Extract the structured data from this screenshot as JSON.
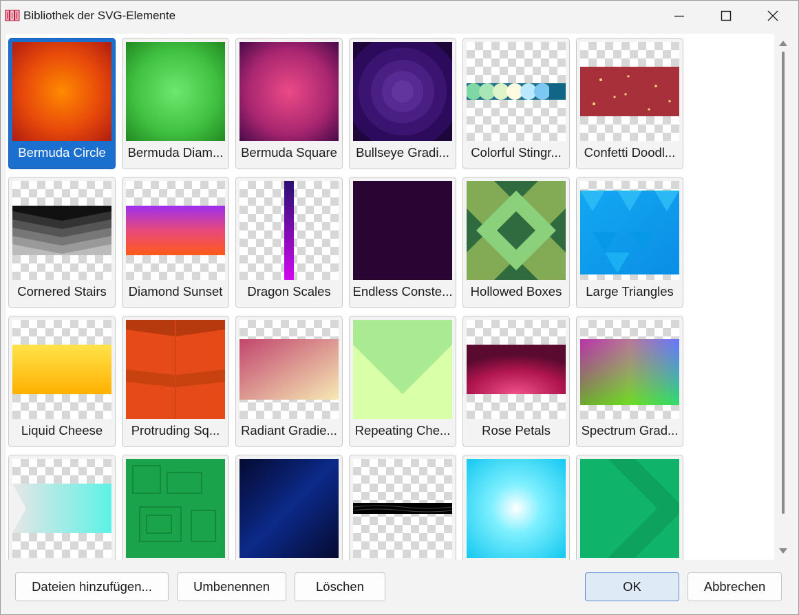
{
  "window": {
    "title": "Bibliothek der SVG-Elemente"
  },
  "tiles": [
    {
      "label": "Bermuda Circle",
      "selected": true
    },
    {
      "label": "Bermuda Diam..."
    },
    {
      "label": "Bermuda Square"
    },
    {
      "label": "Bullseye Gradi..."
    },
    {
      "label": "Colorful Stingr..."
    },
    {
      "label": "Confetti Doodl..."
    },
    {
      "label": "Cornered Stairs"
    },
    {
      "label": "Diamond Sunset"
    },
    {
      "label": "Dragon Scales"
    },
    {
      "label": "Endless Conste..."
    },
    {
      "label": "Hollowed Boxes"
    },
    {
      "label": "Large Triangles"
    },
    {
      "label": "Liquid Cheese"
    },
    {
      "label": "Protruding Sq..."
    },
    {
      "label": "Radiant Gradie..."
    },
    {
      "label": "Repeating Che..."
    },
    {
      "label": "Rose Petals"
    },
    {
      "label": "Spectrum Grad..."
    },
    {
      "label": ""
    },
    {
      "label": ""
    },
    {
      "label": ""
    },
    {
      "label": ""
    },
    {
      "label": ""
    },
    {
      "label": ""
    }
  ],
  "buttons": {
    "add_files": "Dateien hinzufügen...",
    "rename": "Umbenennen",
    "delete": "Löschen",
    "ok": "OK",
    "cancel": "Abbrechen"
  },
  "colors": {
    "selection": "#1a6fcf",
    "ok_button": "#dfeaf7"
  }
}
